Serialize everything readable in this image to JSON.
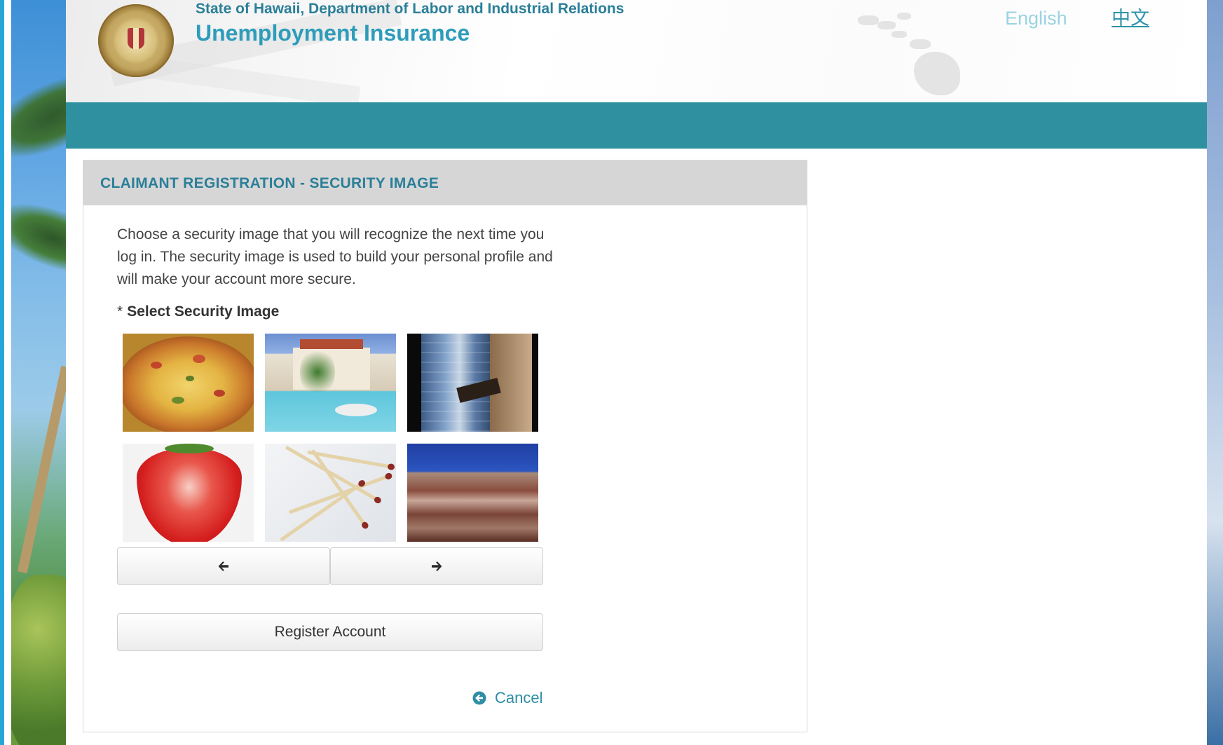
{
  "header": {
    "department": "State of Hawaii, Department of Labor and Industrial Relations",
    "title": "Unemployment Insurance",
    "languages": [
      "English",
      "中文"
    ]
  },
  "panel": {
    "title": "CLAIMANT REGISTRATION - SECURITY IMAGE",
    "intro": "Choose a security image that you will recognize the next time you log in. The security image is used to build your personal profile and will make your account more secure.",
    "required_marker": "*",
    "select_label": "Select Security Image",
    "images": [
      "pizza",
      "resort-pool",
      "skyscraper",
      "strawberry",
      "matchsticks",
      "painted-desert"
    ],
    "register_label": "Register Account",
    "cancel_label": "Cancel"
  },
  "colors": {
    "teal_bar": "#2f90a0",
    "title_blue": "#2e9cba",
    "panel_title": "#2b7f98",
    "panel_header_bg": "#d6d6d6"
  }
}
